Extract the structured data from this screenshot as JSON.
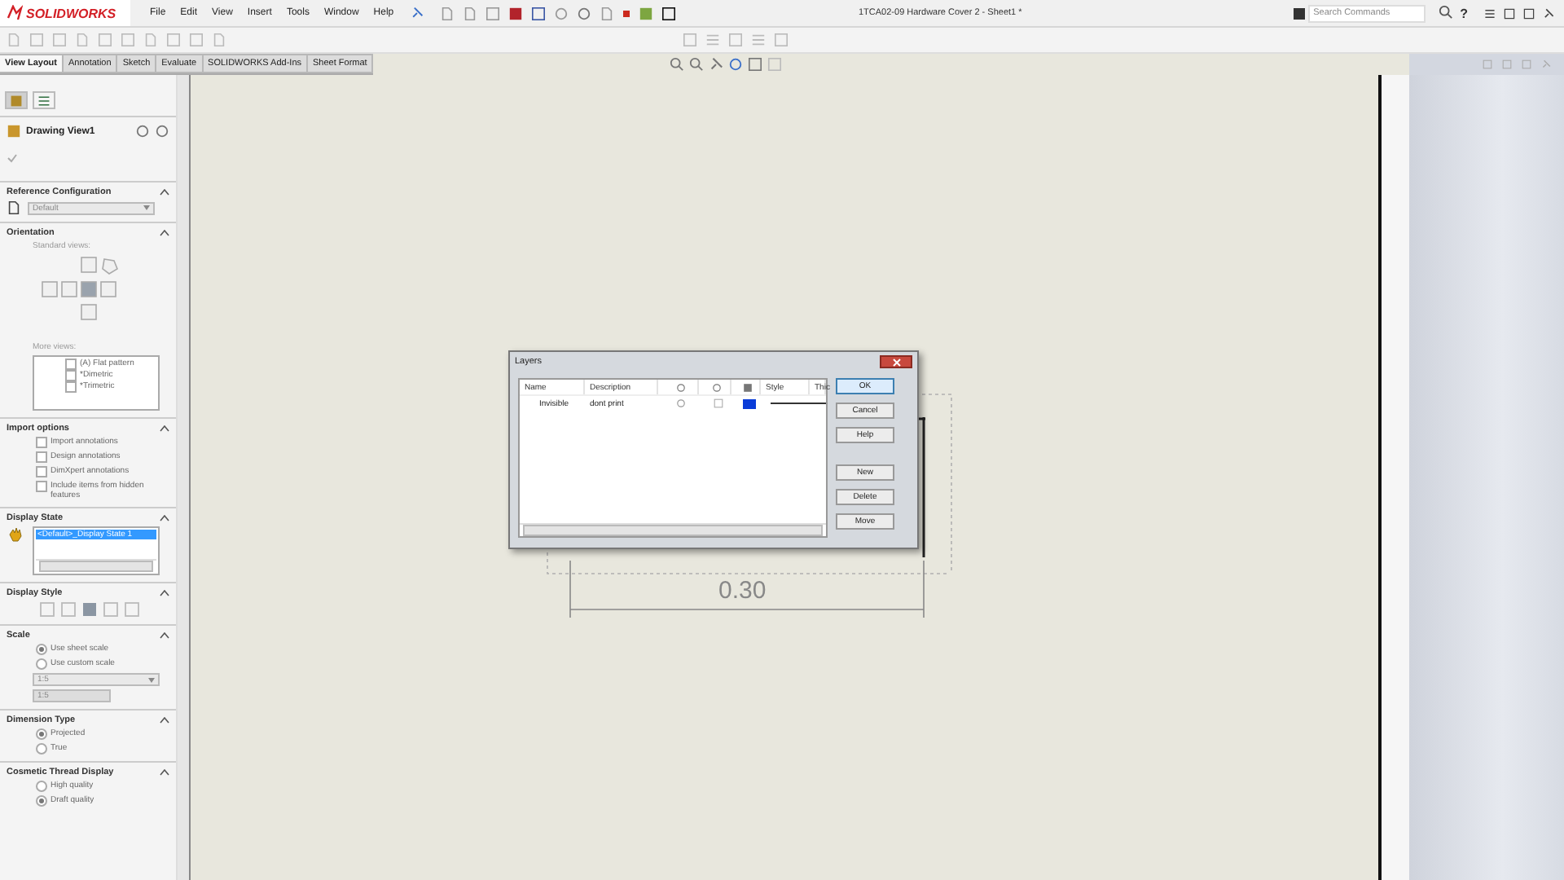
{
  "logo": {
    "text": "SOLIDWORKS"
  },
  "menu": [
    "File",
    "Edit",
    "View",
    "Insert",
    "Tools",
    "Window",
    "Help"
  ],
  "document_title": "1TCA02-09 Hardware Cover 2 - Sheet1 *",
  "search": {
    "placeholder": "Search Commands"
  },
  "help": "?",
  "tabs": [
    {
      "label": "View Layout",
      "selected": true
    },
    {
      "label": "Annotation",
      "selected": false
    },
    {
      "label": "Sketch",
      "selected": false
    },
    {
      "label": "Evaluate",
      "selected": false
    },
    {
      "label": "SOLIDWORKS Add-Ins",
      "selected": false
    },
    {
      "label": "Sheet Format",
      "selected": false
    }
  ],
  "panel_tabs": [
    {
      "kind": "property",
      "selected": true
    },
    {
      "kind": "tree",
      "selected": false
    }
  ],
  "property_manager": {
    "title": "Drawing View1",
    "sections": [
      {
        "title": "Reference Configuration",
        "items": [
          {
            "kind": "dropdown",
            "value": "Default"
          }
        ]
      },
      {
        "title": "Orientation",
        "items": [
          {
            "kind": "label",
            "text": "Standard views:"
          },
          {
            "kind": "views"
          },
          {
            "kind": "label",
            "text": "More views:"
          },
          {
            "kind": "checklist",
            "options": [
              {
                "text": "(A) Flat pattern",
                "checked": false
              },
              {
                "text": "*Dimetric",
                "checked": false
              },
              {
                "text": "*Trimetric",
                "checked": false
              }
            ]
          }
        ]
      },
      {
        "title": "Import options",
        "items": [
          {
            "kind": "checkbox",
            "text": "Import annotations",
            "checked": false
          },
          {
            "kind": "checkbox",
            "text": "Design annotations",
            "checked": false
          },
          {
            "kind": "checkbox",
            "text": "DimXpert annotations",
            "checked": false
          },
          {
            "kind": "checkbox",
            "text": "Include items from hidden features",
            "checked": false
          }
        ]
      },
      {
        "title": "Display State",
        "items": [
          {
            "kind": "listbox",
            "options": [
              {
                "text": "<Default>_Display State 1",
                "selected": true
              }
            ]
          }
        ]
      },
      {
        "title": "Display Style",
        "items": [
          {
            "kind": "styles"
          }
        ]
      },
      {
        "title": "Scale",
        "items": [
          {
            "kind": "radio",
            "text": "Use sheet scale",
            "checked": true
          },
          {
            "kind": "radio",
            "text": "Use custom scale",
            "checked": false
          },
          {
            "kind": "dropdown",
            "value": "1:5"
          },
          {
            "kind": "field",
            "value": "1:5"
          }
        ]
      },
      {
        "title": "Dimension Type",
        "items": [
          {
            "kind": "radio",
            "text": "Projected",
            "checked": true
          },
          {
            "kind": "radio",
            "text": "True",
            "checked": false
          }
        ]
      },
      {
        "title": "Cosmetic Thread Display",
        "items": [
          {
            "kind": "radio",
            "text": "High quality",
            "checked": false
          },
          {
            "kind": "radio",
            "text": "Draft quality",
            "checked": true
          }
        ]
      }
    ]
  },
  "drawing": {
    "dimension": "0.30"
  },
  "dialog": {
    "title": "Layers",
    "columns": [
      {
        "kind": "text",
        "label": "Name"
      },
      {
        "kind": "text",
        "label": "Description"
      },
      {
        "kind": "icon"
      },
      {
        "kind": "icon"
      },
      {
        "kind": "icon"
      },
      {
        "kind": "text",
        "label": "Style"
      },
      {
        "kind": "text",
        "label": "Thic"
      }
    ],
    "rows": [
      {
        "name": "Invisible",
        "description": "dont print",
        "color": "#0a3cd8"
      }
    ],
    "buttons": [
      {
        "label": "OK",
        "default": true
      },
      {
        "label": "Cancel",
        "default": false
      },
      {
        "label": "Help",
        "default": false
      },
      {
        "label": "New",
        "default": false
      },
      {
        "label": "Delete",
        "default": false
      },
      {
        "label": "Move",
        "default": false
      }
    ]
  }
}
